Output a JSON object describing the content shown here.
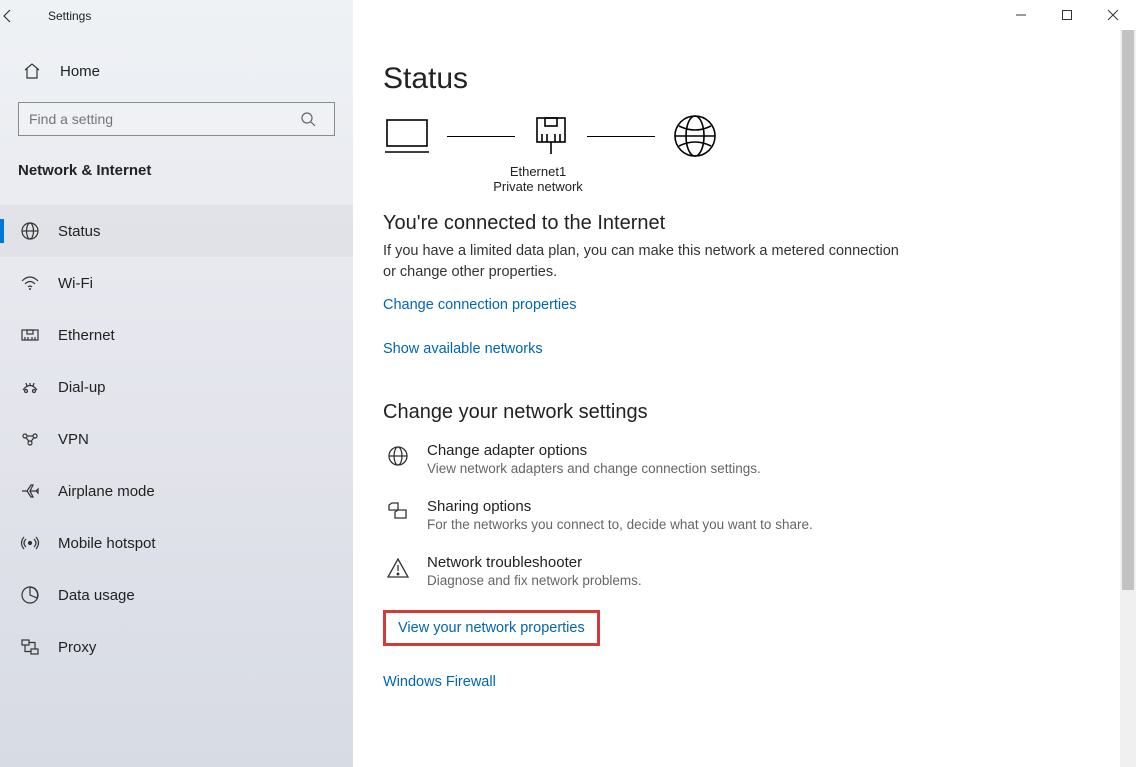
{
  "window": {
    "title": "Settings"
  },
  "sidebar": {
    "home": "Home",
    "search_placeholder": "Find a setting",
    "section": "Network & Internet",
    "items": [
      {
        "label": "Status"
      },
      {
        "label": "Wi-Fi"
      },
      {
        "label": "Ethernet"
      },
      {
        "label": "Dial-up"
      },
      {
        "label": "VPN"
      },
      {
        "label": "Airplane mode"
      },
      {
        "label": "Mobile hotspot"
      },
      {
        "label": "Data usage"
      },
      {
        "label": "Proxy"
      }
    ]
  },
  "main": {
    "heading": "Status",
    "connection": {
      "name": "Ethernet1",
      "type": "Private network"
    },
    "connected_heading": "You're connected to the Internet",
    "connected_body": "If you have a limited data plan, you can make this network a metered connection or change other properties.",
    "link_change_props": "Change connection properties",
    "link_show_networks": "Show available networks",
    "change_heading": "Change your network settings",
    "options": [
      {
        "title": "Change adapter options",
        "desc": "View network adapters and change connection settings."
      },
      {
        "title": "Sharing options",
        "desc": "For the networks you connect to, decide what you want to share."
      },
      {
        "title": "Network troubleshooter",
        "desc": "Diagnose and fix network problems."
      }
    ],
    "link_view_props": "View your network properties",
    "link_firewall": "Windows Firewall"
  }
}
